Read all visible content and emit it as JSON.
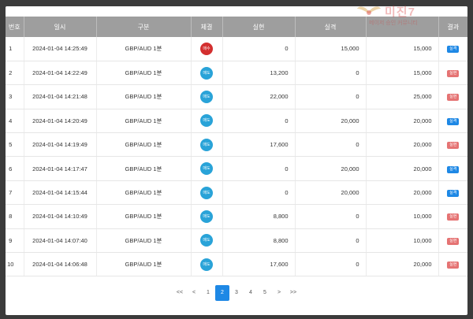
{
  "table": {
    "headers": [
      "번호",
      "일시",
      "구분",
      "체결",
      "실현",
      "실격",
      "",
      "결과"
    ],
    "rows": [
      {
        "no": "1",
        "datetime": "2024-01-04 14:25:49",
        "category": "GBP/AUD 1분",
        "trade": "매수",
        "trade_color": "#d32f2f",
        "realized": "0",
        "failed": "15,000",
        "total": "15,000",
        "result": "실격",
        "result_color": "#1e88e5"
      },
      {
        "no": "2",
        "datetime": "2024-01-04 14:22:49",
        "category": "GBP/AUD 1분",
        "trade": "매도",
        "trade_color": "#29a3d8",
        "realized": "13,200",
        "failed": "0",
        "total": "15,000",
        "result": "실현",
        "result_color": "#e57373"
      },
      {
        "no": "3",
        "datetime": "2024-01-04 14:21:48",
        "category": "GBP/AUD 1분",
        "trade": "매도",
        "trade_color": "#29a3d8",
        "realized": "22,000",
        "failed": "0",
        "total": "25,000",
        "result": "실현",
        "result_color": "#e57373"
      },
      {
        "no": "4",
        "datetime": "2024-01-04 14:20:49",
        "category": "GBP/AUD 1분",
        "trade": "매도",
        "trade_color": "#29a3d8",
        "realized": "0",
        "failed": "20,000",
        "total": "20,000",
        "result": "실격",
        "result_color": "#1e88e5"
      },
      {
        "no": "5",
        "datetime": "2024-01-04 14:19:49",
        "category": "GBP/AUD 1분",
        "trade": "매도",
        "trade_color": "#29a3d8",
        "realized": "17,600",
        "failed": "0",
        "total": "20,000",
        "result": "실현",
        "result_color": "#e57373"
      },
      {
        "no": "6",
        "datetime": "2024-01-04 14:17:47",
        "category": "GBP/AUD 1분",
        "trade": "매도",
        "trade_color": "#29a3d8",
        "realized": "0",
        "failed": "20,000",
        "total": "20,000",
        "result": "실격",
        "result_color": "#1e88e5"
      },
      {
        "no": "7",
        "datetime": "2024-01-04 14:15:44",
        "category": "GBP/AUD 1분",
        "trade": "매도",
        "trade_color": "#29a3d8",
        "realized": "0",
        "failed": "20,000",
        "total": "20,000",
        "result": "실격",
        "result_color": "#1e88e5"
      },
      {
        "no": "8",
        "datetime": "2024-01-04 14:10:49",
        "category": "GBP/AUD 1분",
        "trade": "매도",
        "trade_color": "#29a3d8",
        "realized": "8,800",
        "failed": "0",
        "total": "10,000",
        "result": "실현",
        "result_color": "#e57373"
      },
      {
        "no": "9",
        "datetime": "2024-01-04 14:07:40",
        "category": "GBP/AUD 1분",
        "trade": "매도",
        "trade_color": "#29a3d8",
        "realized": "8,800",
        "failed": "0",
        "total": "10,000",
        "result": "실현",
        "result_color": "#e57373"
      },
      {
        "no": "10",
        "datetime": "2024-01-04 14:06:48",
        "category": "GBP/AUD 1분",
        "trade": "매도",
        "trade_color": "#29a3d8",
        "realized": "17,600",
        "failed": "0",
        "total": "20,000",
        "result": "실현",
        "result_color": "#e57373"
      }
    ]
  },
  "pagination": {
    "items": [
      "<<",
      "<",
      "1",
      "2",
      "3",
      "4",
      "5",
      ">",
      ">>"
    ],
    "active": "2"
  },
  "watermark": {
    "title": "미진7",
    "subtitle": "메이저 승인 커뮤니티"
  }
}
